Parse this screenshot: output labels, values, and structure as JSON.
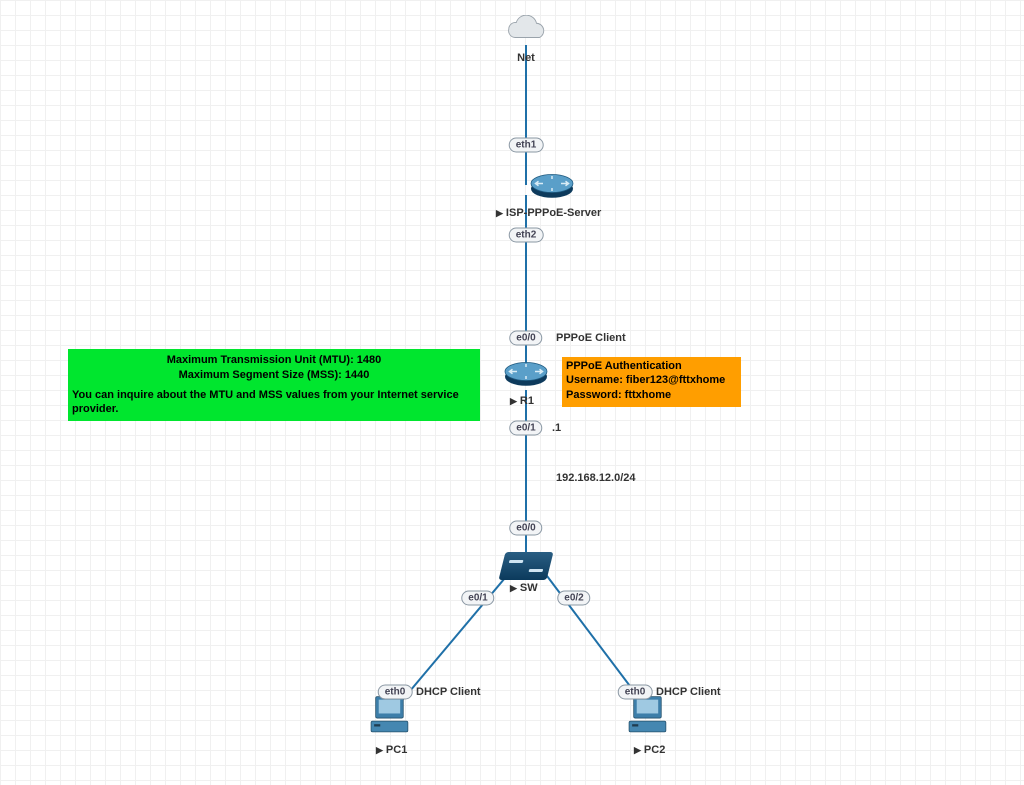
{
  "diagram": {
    "nodes": {
      "net": {
        "label": "Net"
      },
      "isp": {
        "label": "ISP-PPPoE-Server"
      },
      "r1": {
        "label": "R1"
      },
      "sw": {
        "label": "SW"
      },
      "pc1": {
        "label": "PC1"
      },
      "pc2": {
        "label": "PC2"
      }
    },
    "ports": {
      "isp_eth1": "eth1",
      "isp_eth2": "eth2",
      "r1_e00": "e0/0",
      "r1_e01": "e0/1",
      "sw_e00": "e0/0",
      "sw_e01": "e0/1",
      "sw_e02": "e0/2",
      "pc1_eth0": "eth0",
      "pc2_eth0": "eth0"
    },
    "labels": {
      "pppoe_client": "PPPoE Client",
      "host_ip": ".1",
      "subnet": "192.168.12.0/24",
      "dhcp_client1": "DHCP Client",
      "dhcp_client2": "DHCP Client"
    },
    "green_box": {
      "line1": "Maximum Transmission Unit (MTU): 1480",
      "line2": "Maximum Segment Size (MSS): 1440",
      "line3": "You can inquire about the MTU and MSS values from your Internet service provider."
    },
    "orange_box": {
      "line1": "PPPoE Authentication",
      "line2": "Username: fiber123@fttxhome",
      "line3": "Password: fttxhome"
    }
  }
}
